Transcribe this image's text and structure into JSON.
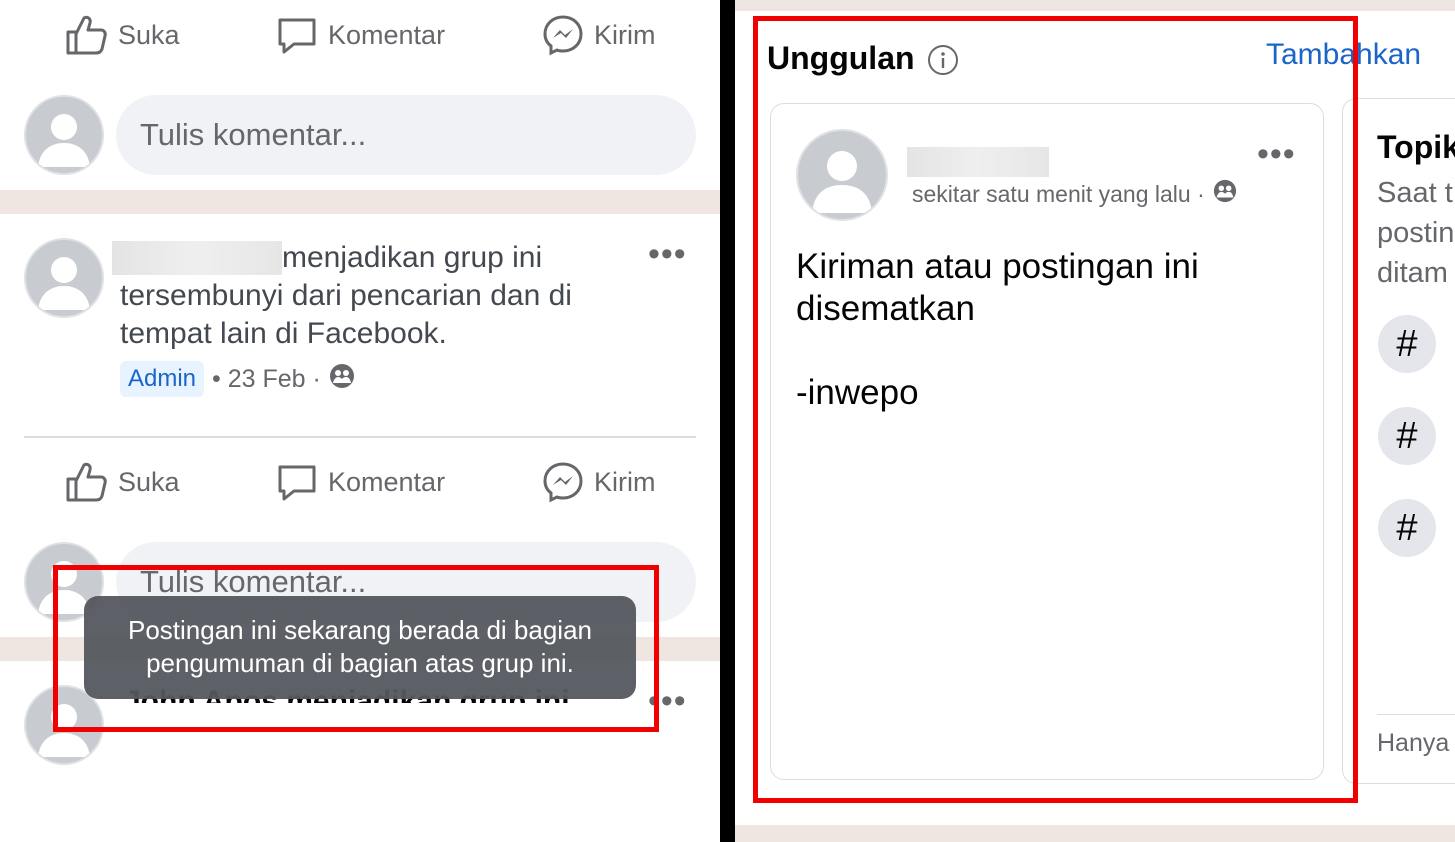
{
  "left": {
    "actions_top": {
      "like": "Suka",
      "comment": "Komentar",
      "send": "Kirim"
    },
    "comment_placeholder_1": "Tulis komentar...",
    "post": {
      "text_part1": "menjadikan grup ini",
      "text_part2": "tersembunyi dari pencarian dan di",
      "text_part3": "tempat lain di Facebook.",
      "badge": "Admin",
      "date": "• 23 Feb ·"
    },
    "actions_bottom": {
      "like": "Suka",
      "comment": "Komentar",
      "send": "Kirim"
    },
    "comment_placeholder_2": "Tulis komentar...",
    "toast": {
      "line1": "Postingan ini sekarang berada di bagian",
      "line2": "pengumuman di bagian atas grup ini."
    },
    "next_post_partial": "John Apos menjadikan grup ini"
  },
  "right": {
    "section_title": "Unggulan",
    "add_link": "Tambahkan",
    "card": {
      "time": "sekitar satu menit yang lalu ·",
      "body_line1": "Kiriman atau postingan ini",
      "body_line2": "disematkan",
      "signature": "-inwepo"
    },
    "topics": {
      "title": "Topik",
      "line1": "Saat t",
      "line2": "postin",
      "line3": "ditam",
      "hash": "#",
      "footer": "Hanya"
    }
  },
  "colors": {
    "highlight": "#f00000",
    "link": "#1b64c8",
    "separator": "#efe6e1"
  }
}
